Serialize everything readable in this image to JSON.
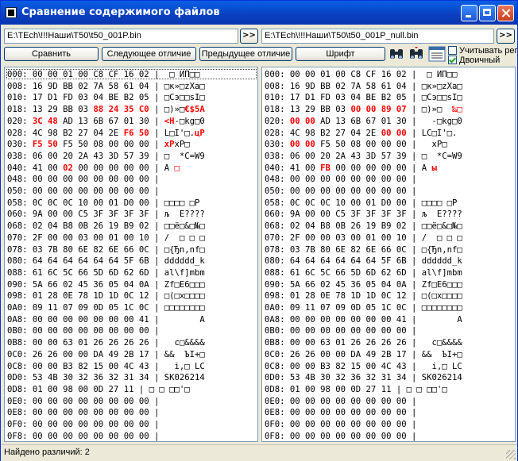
{
  "window": {
    "title": "Сравнение содержимого файлов"
  },
  "files": {
    "left_path": "E:\\TEch\\!!!Наши\\T50\\t50_001P.bin",
    "right_path": "E:\\TEch\\!!!Наши\\T50\\t50_001P_null.bin",
    "browse_label": ">>"
  },
  "toolbar": {
    "compare": "Сравнить",
    "next_diff": "Следующее отличие",
    "prev_diff": "Предыдущее отличие",
    "font": "Шрифт",
    "tool_icons": [
      "binoculars-icon",
      "binoculars-next-icon",
      "hex-grid-icon"
    ],
    "checkbox_case": {
      "label": "Учитывать регистр",
      "checked": false
    },
    "checkbox_binary": {
      "label": "Двоичный",
      "checked": true
    }
  },
  "colors": {
    "diff": "#ff0000",
    "title_bar": "#0a4fd8",
    "face": "#ece9d8"
  },
  "left_lines": [
    [
      {
        "t": "000: 00 00 01 00 C8 CF 16 02 |  □ ИП□□"
      }
    ],
    [
      {
        "t": "008: 16 9D BB 02 7A 58 61 04 | □к»□zXa□"
      }
    ],
    [
      {
        "t": "010: 17 D1 FD 03 04 BE B2 05 | □Сэ□□sІ□"
      }
    ],
    [
      {
        "t": "018: 13 29 BB 03 "
      },
      {
        "t": "88 24 35 C0",
        "d": true
      },
      {
        "t": " | □)»□"
      },
      {
        "t": "€$5А",
        "d": true
      }
    ],
    [
      {
        "t": "020: "
      },
      {
        "t": "3C 48",
        "d": true
      },
      {
        "t": " AD 13 6B 67 01 30 | "
      },
      {
        "t": "<H",
        "d": true
      },
      {
        "t": "-□kg□0"
      }
    ],
    [
      {
        "t": "028: 4C 98 B2 27 04 2E "
      },
      {
        "t": "F6 50",
        "d": true
      },
      {
        "t": " | L□І'□."
      },
      {
        "t": "цP",
        "d": true
      }
    ],
    [
      {
        "t": "030: "
      },
      {
        "t": "F5 50",
        "d": true
      },
      {
        "t": " F5 50 08 00 00 00 | "
      },
      {
        "t": "хP",
        "d": true
      },
      {
        "t": "хP□"
      }
    ],
    [
      {
        "t": "038: 06 00 20 2A 43 3D 57 39 | □  *C=W9"
      }
    ],
    [
      {
        "t": "040: 41 00 "
      },
      {
        "t": "02",
        "d": true
      },
      {
        "t": " 00 00 00 00 00 | A "
      },
      {
        "t": "□",
        "d": true
      }
    ],
    [
      {
        "t": "048: 00 00 00 00 00 00 00 00 |"
      }
    ],
    [
      {
        "t": "050: 00 00 00 00 00 00 00 00 |"
      }
    ],
    [
      {
        "t": "058: 0C 0C 0C 10 00 01 D0 00 | □□□□ □Р"
      }
    ],
    [
      {
        "t": "060: 9A 00 00 C5 3F 3F 3F 3F | љ  Е????"
      }
    ],
    [
      {
        "t": "068: 02 04 B8 0B 26 19 B9 02 | □□ё□&□№□"
      }
    ],
    [
      {
        "t": "070: 2F 00 00 03 00 01 00 10 | /  □ □ □"
      }
    ],
    [
      {
        "t": "078: 03 7B 80 6E 82 6E 66 0C | □{Ђn‚nf□"
      }
    ],
    [
      {
        "t": "080: 64 64 64 64 64 64 5F 6B | dddddd_k"
      }
    ],
    [
      {
        "t": "088: 61 6C 5C 66 5D 6D 62 6D | al\\f]mbm"
      }
    ],
    [
      {
        "t": "090: 5A 66 02 45 36 05 04 0A | Zf□E6□□□"
      }
    ],
    [
      {
        "t": "098: 01 28 0E 78 1D 1D 0C 12 | □(□x□□□□"
      }
    ],
    [
      {
        "t": "0A0: 09 11 07 09 0D 05 1C 0C | □□□□□□□□"
      }
    ],
    [
      {
        "t": "0A8: 00 00 00 00 00 00 00 41 |        A"
      }
    ],
    [
      {
        "t": "0B0: 00 00 00 00 00 00 00 00 |"
      }
    ],
    [
      {
        "t": "0B8: 00 00 63 01 26 26 26 26 |   c□&&&&"
      }
    ],
    [
      {
        "t": "0C0: 26 26 00 00 DA 49 2B 17 | &&  ЪI+□"
      }
    ],
    [
      {
        "t": "0C8: 00 00 B3 82 15 00 4C 43 |   і‚□ LC"
      }
    ],
    [
      {
        "t": "0D0: 53 4B 30 32 36 32 31 34 | SK026214"
      }
    ],
    [
      {
        "t": "0D8: 01 00 98 00 0D 27 11 | □ □ □□'□"
      }
    ],
    [
      {
        "t": "0E0: 00 00 00 00 00 00 00 00 |"
      }
    ],
    [
      {
        "t": "0E8: 00 00 00 00 00 00 00 00 |"
      }
    ],
    [
      {
        "t": "0F0: 00 00 00 00 00 00 00 00 |"
      }
    ],
    [
      {
        "t": "0F8: 00 00 00 00 00 00 00 00 |"
      }
    ]
  ],
  "right_lines": [
    [
      {
        "t": "000: 00 00 01 00 C8 CF 16 02 |  □ ИП□□"
      }
    ],
    [
      {
        "t": "008: 16 9D BB 02 7A 58 61 04 | □к»□zXa□"
      }
    ],
    [
      {
        "t": "010: 17 D1 FD 03 04 BE B2 05 | □Сэ□□sІ□"
      }
    ],
    [
      {
        "t": "018: 13 29 BB 03 "
      },
      {
        "t": "00 00 89 07",
        "d": true
      },
      {
        "t": " | □)»□  "
      },
      {
        "t": "‰□",
        "d": true
      }
    ],
    [
      {
        "t": "020: "
      },
      {
        "t": "00 00",
        "d": true
      },
      {
        "t": " AD 13 6B 67 01 30 |   -□kg□0"
      }
    ],
    [
      {
        "t": "028: 4C 98 B2 27 04 2E "
      },
      {
        "t": "00 00",
        "d": true
      },
      {
        "t": " | LC□І'□."
      }
    ],
    [
      {
        "t": "030: "
      },
      {
        "t": "00 00",
        "d": true
      },
      {
        "t": " F5 50 08 00 00 00 |   хP□"
      }
    ],
    [
      {
        "t": "038: 06 00 20 2A 43 3D 57 39 | □  *C=W9"
      }
    ],
    [
      {
        "t": "040: 41 00 "
      },
      {
        "t": "FB",
        "d": true
      },
      {
        "t": " 00 00 00 00 00 | A "
      },
      {
        "t": "ы",
        "d": true
      }
    ],
    [
      {
        "t": "048: 00 00 00 00 00 00 00 00 |"
      }
    ],
    [
      {
        "t": "050: 00 00 00 00 00 00 00 00 |"
      }
    ],
    [
      {
        "t": "058: 0C 0C 0C 10 00 01 D0 00 | □□□□ □Р"
      }
    ],
    [
      {
        "t": "060: 9A 00 00 C5 3F 3F 3F 3F | љ  Е????"
      }
    ],
    [
      {
        "t": "068: 02 04 B8 0B 26 19 B9 02 | □□ё□&□№□"
      }
    ],
    [
      {
        "t": "070: 2F 00 00 03 00 01 00 10 | /  □ □ □"
      }
    ],
    [
      {
        "t": "078: 03 7B 80 6E 82 6E 66 0C | □{Ђn‚nf□"
      }
    ],
    [
      {
        "t": "080: 64 64 64 64 64 64 5F 6B | dddddd_k"
      }
    ],
    [
      {
        "t": "088: 61 6C 5C 66 5D 6D 62 6D | al\\f]mbm"
      }
    ],
    [
      {
        "t": "090: 5A 66 02 45 36 05 04 0A | Zf□E6□□□"
      }
    ],
    [
      {
        "t": "098: 01 28 0E 78 1D 1D 0C 12 | □(□x□□□□"
      }
    ],
    [
      {
        "t": "0A0: 09 11 07 09 0D 05 1C 0C | □□□□□□□□"
      }
    ],
    [
      {
        "t": "0A8: 00 00 00 00 00 00 00 41 |        A"
      }
    ],
    [
      {
        "t": "0B0: 00 00 00 00 00 00 00 00 |"
      }
    ],
    [
      {
        "t": "0B8: 00 00 63 01 26 26 26 26 |   c□&&&&"
      }
    ],
    [
      {
        "t": "0C0: 26 26 00 00 DA 49 2B 17 | &&  ЪI+□"
      }
    ],
    [
      {
        "t": "0C8: 00 00 B3 82 15 00 4C 43 |   і‚□ LC"
      }
    ],
    [
      {
        "t": "0D0: 53 4B 30 32 36 32 31 34 | SK026214"
      }
    ],
    [
      {
        "t": "0D8: 01 00 98 00 0D 27 11 | □ □ □□'□"
      }
    ],
    [
      {
        "t": "0E0: 00 00 00 00 00 00 00 00 |"
      }
    ],
    [
      {
        "t": "0E8: 00 00 00 00 00 00 00 00 |"
      }
    ],
    [
      {
        "t": "0F0: 00 00 00 00 00 00 00 00 |"
      }
    ],
    [
      {
        "t": "0F8: 00 00 00 00 00 00 00 00 |"
      }
    ]
  ],
  "status": {
    "text": "Найдено различий: 2"
  }
}
